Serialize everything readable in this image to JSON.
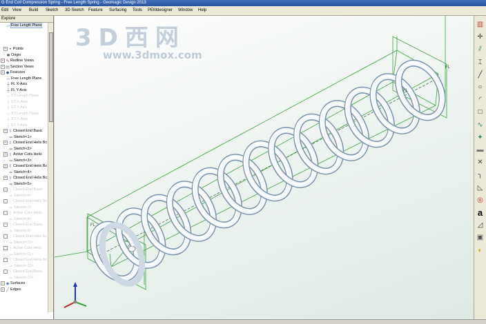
{
  "window": {
    "title": "G End Coil Compression Spring - Free Length Spring - Geomagic Design 2013"
  },
  "menu": [
    "Edit",
    "View",
    "Build",
    "Sketch",
    "3D Sketch",
    "Feature",
    "Surfacing",
    "Tools",
    "PEMdesigner",
    "Window",
    "Help"
  ],
  "watermark": {
    "cn": "3D西网",
    "url": "www.3dmox.com"
  },
  "explorer": {
    "title": "Explore",
    "items": [
      {
        "label": "Free Length Plane",
        "icon": "plane-icon",
        "indent": 2,
        "faded": false,
        "selected": true
      },
      {
        "label": "",
        "icon": "",
        "indent": 2,
        "faded": true
      },
      {
        "label": "",
        "icon": "",
        "indent": 2,
        "faded": true
      },
      {
        "label": "",
        "icon": "",
        "indent": 2,
        "faded": true
      },
      {
        "label": "Points",
        "icon": "points-icon",
        "indent": 1,
        "faded": false
      },
      {
        "label": "Origin",
        "icon": "origin-icon",
        "indent": 2,
        "faded": false
      },
      {
        "label": "Redline Views",
        "icon": "redline-icon",
        "indent": 0,
        "faded": false
      },
      {
        "label": "Section Views",
        "icon": "section-icon",
        "indent": 0,
        "faded": false
      },
      {
        "label": "Features",
        "icon": "features-icon",
        "indent": 0,
        "faded": false
      },
      {
        "label": "Free Length Plane",
        "icon": "plane-icon",
        "indent": 2,
        "faded": false
      },
      {
        "label": "FL X-Axis",
        "icon": "axis-icon",
        "indent": 2,
        "faded": false
      },
      {
        "label": "FL Y-Axis",
        "icon": "axis-icon",
        "indent": 2,
        "faded": false
      },
      {
        "label": "ST Length Plane",
        "icon": "plane-icon",
        "indent": 2,
        "faded": true
      },
      {
        "label": "ST X-Axis",
        "icon": "axis-icon",
        "indent": 2,
        "faded": true
      },
      {
        "label": "ST Y-Axis",
        "icon": "axis-icon",
        "indent": 2,
        "faded": true
      },
      {
        "label": "ST Length Plane",
        "icon": "plane-icon",
        "indent": 2,
        "faded": true
      },
      {
        "label": "ST X-Axis",
        "icon": "axis-icon",
        "indent": 2,
        "faded": true
      },
      {
        "label": "ST Y-Axis",
        "icon": "axis-icon",
        "indent": 2,
        "faded": true
      },
      {
        "label": "Closed End Basic",
        "icon": "feature-icon",
        "indent": 1,
        "faded": false
      },
      {
        "label": "Sketch<1>",
        "icon": "sketch-icon",
        "indent": 3,
        "faded": false
      },
      {
        "label": "Closed End Helix Bc",
        "icon": "feature-icon",
        "indent": 1,
        "faded": false
      },
      {
        "label": "Sketch<2>",
        "icon": "sketch-icon",
        "indent": 3,
        "faded": false
      },
      {
        "label": "Active Coils Helix",
        "icon": "feature-icon",
        "indent": 1,
        "faded": false
      },
      {
        "label": "Sketch<3>",
        "icon": "sketch-icon",
        "indent": 3,
        "faded": false
      },
      {
        "label": "Closed End Helix Bc",
        "icon": "feature-icon",
        "indent": 1,
        "faded": false
      },
      {
        "label": "Sketch<4>",
        "icon": "sketch-icon",
        "indent": 3,
        "faded": false
      },
      {
        "label": "Closed End Helix Bc",
        "icon": "feature-icon",
        "indent": 1,
        "faded": false
      },
      {
        "label": "Sketch<5>",
        "icon": "sketch-icon",
        "indent": 3,
        "faded": false
      },
      {
        "label": "Closed End Basic",
        "icon": "feature-icon",
        "indent": 1,
        "faded": true
      },
      {
        "label": "Sketch<6>",
        "icon": "sketch-icon",
        "indent": 3,
        "faded": true
      },
      {
        "label": "Closed End Helix Bc",
        "icon": "feature-icon",
        "indent": 1,
        "faded": true
      },
      {
        "label": "Sketch<7>",
        "icon": "sketch-icon",
        "indent": 3,
        "faded": true
      },
      {
        "label": "Active Coils Helix",
        "icon": "feature-icon",
        "indent": 1,
        "faded": true
      },
      {
        "label": "Sketch<8>",
        "icon": "sketch-icon",
        "indent": 3,
        "faded": true
      },
      {
        "label": "Closed End Basic",
        "icon": "feature-icon",
        "indent": 1,
        "faded": true
      },
      {
        "label": "Sketch<9>",
        "icon": "sketch-icon",
        "indent": 3,
        "faded": true
      },
      {
        "label": "Closed End Helix Bc",
        "icon": "feature-icon",
        "indent": 1,
        "faded": true
      },
      {
        "label": "Sketch<10>",
        "icon": "sketch-icon",
        "indent": 3,
        "faded": true
      },
      {
        "label": "Active Coils Helix",
        "icon": "feature-icon",
        "indent": 1,
        "faded": true
      },
      {
        "label": "Sketch<11>",
        "icon": "sketch-icon",
        "indent": 3,
        "faded": true
      },
      {
        "label": "Closed End Helix Bc",
        "icon": "feature-icon",
        "indent": 1,
        "faded": true
      },
      {
        "label": "Sketch<12>",
        "icon": "sketch-icon",
        "indent": 3,
        "faded": true
      },
      {
        "label": "Closed End Basic",
        "icon": "feature-icon",
        "indent": 1,
        "faded": true
      },
      {
        "label": "Sketch<13>",
        "icon": "sketch-icon",
        "indent": 3,
        "faded": true
      },
      {
        "label": "Surfaces",
        "icon": "surfaces-icon",
        "indent": 0,
        "faded": false
      },
      {
        "label": "Edges",
        "icon": "edges-icon",
        "indent": 0,
        "faded": false
      }
    ]
  },
  "viewport": {
    "labels": {
      "top_end": "FL",
      "bottom_end": "FL",
      "axis_mid": "FL"
    }
  },
  "toolbar": [
    "chart-icon",
    "point-icon",
    "parallel-lines-icon",
    "dimension-icon",
    "line-icon",
    "circle-icon",
    "arc-icon",
    "rectangle-icon",
    "spline-icon",
    "star-point-icon",
    "block-icon",
    "cross-icon",
    "fillet-icon",
    "chamfer-icon",
    "circle-red-icon",
    "text-icon",
    "triangle-icon",
    "cube-icon",
    "color-icon"
  ],
  "colors": {
    "accent": "#2a55a0",
    "construction": "#3aa03a",
    "spring": "#f4f7fb",
    "spring_shade": "#7c93ac"
  }
}
